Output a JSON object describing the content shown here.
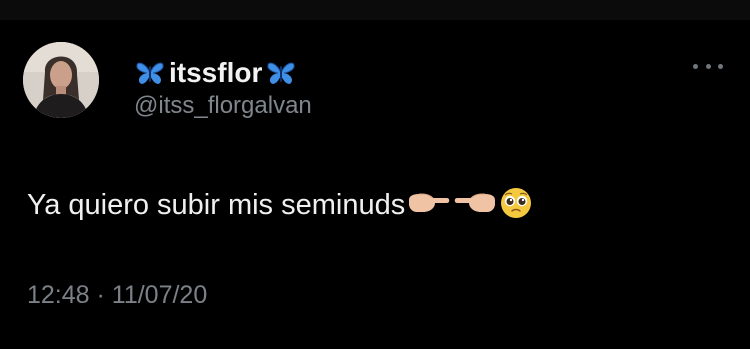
{
  "profile": {
    "display_name": "itssflor",
    "handle": "@itss_florgalvan",
    "name_decoration_icon": "blue-butterfly-emoji",
    "avatar": "profile-photo"
  },
  "tweet": {
    "text": "Ya quiero subir mis seminuds",
    "emojis": [
      "backhand-index-pointing-right",
      "backhand-index-pointing-left",
      "pleading-face"
    ],
    "timestamp": "12:48 · 11/07/20"
  },
  "menu": {
    "icon": "more-horizontal-icon"
  },
  "colors": {
    "background": "#000000",
    "text_primary": "#f0f0f0",
    "text_secondary": "#7f868c",
    "butterfly_blue": "#3f8fe6"
  }
}
